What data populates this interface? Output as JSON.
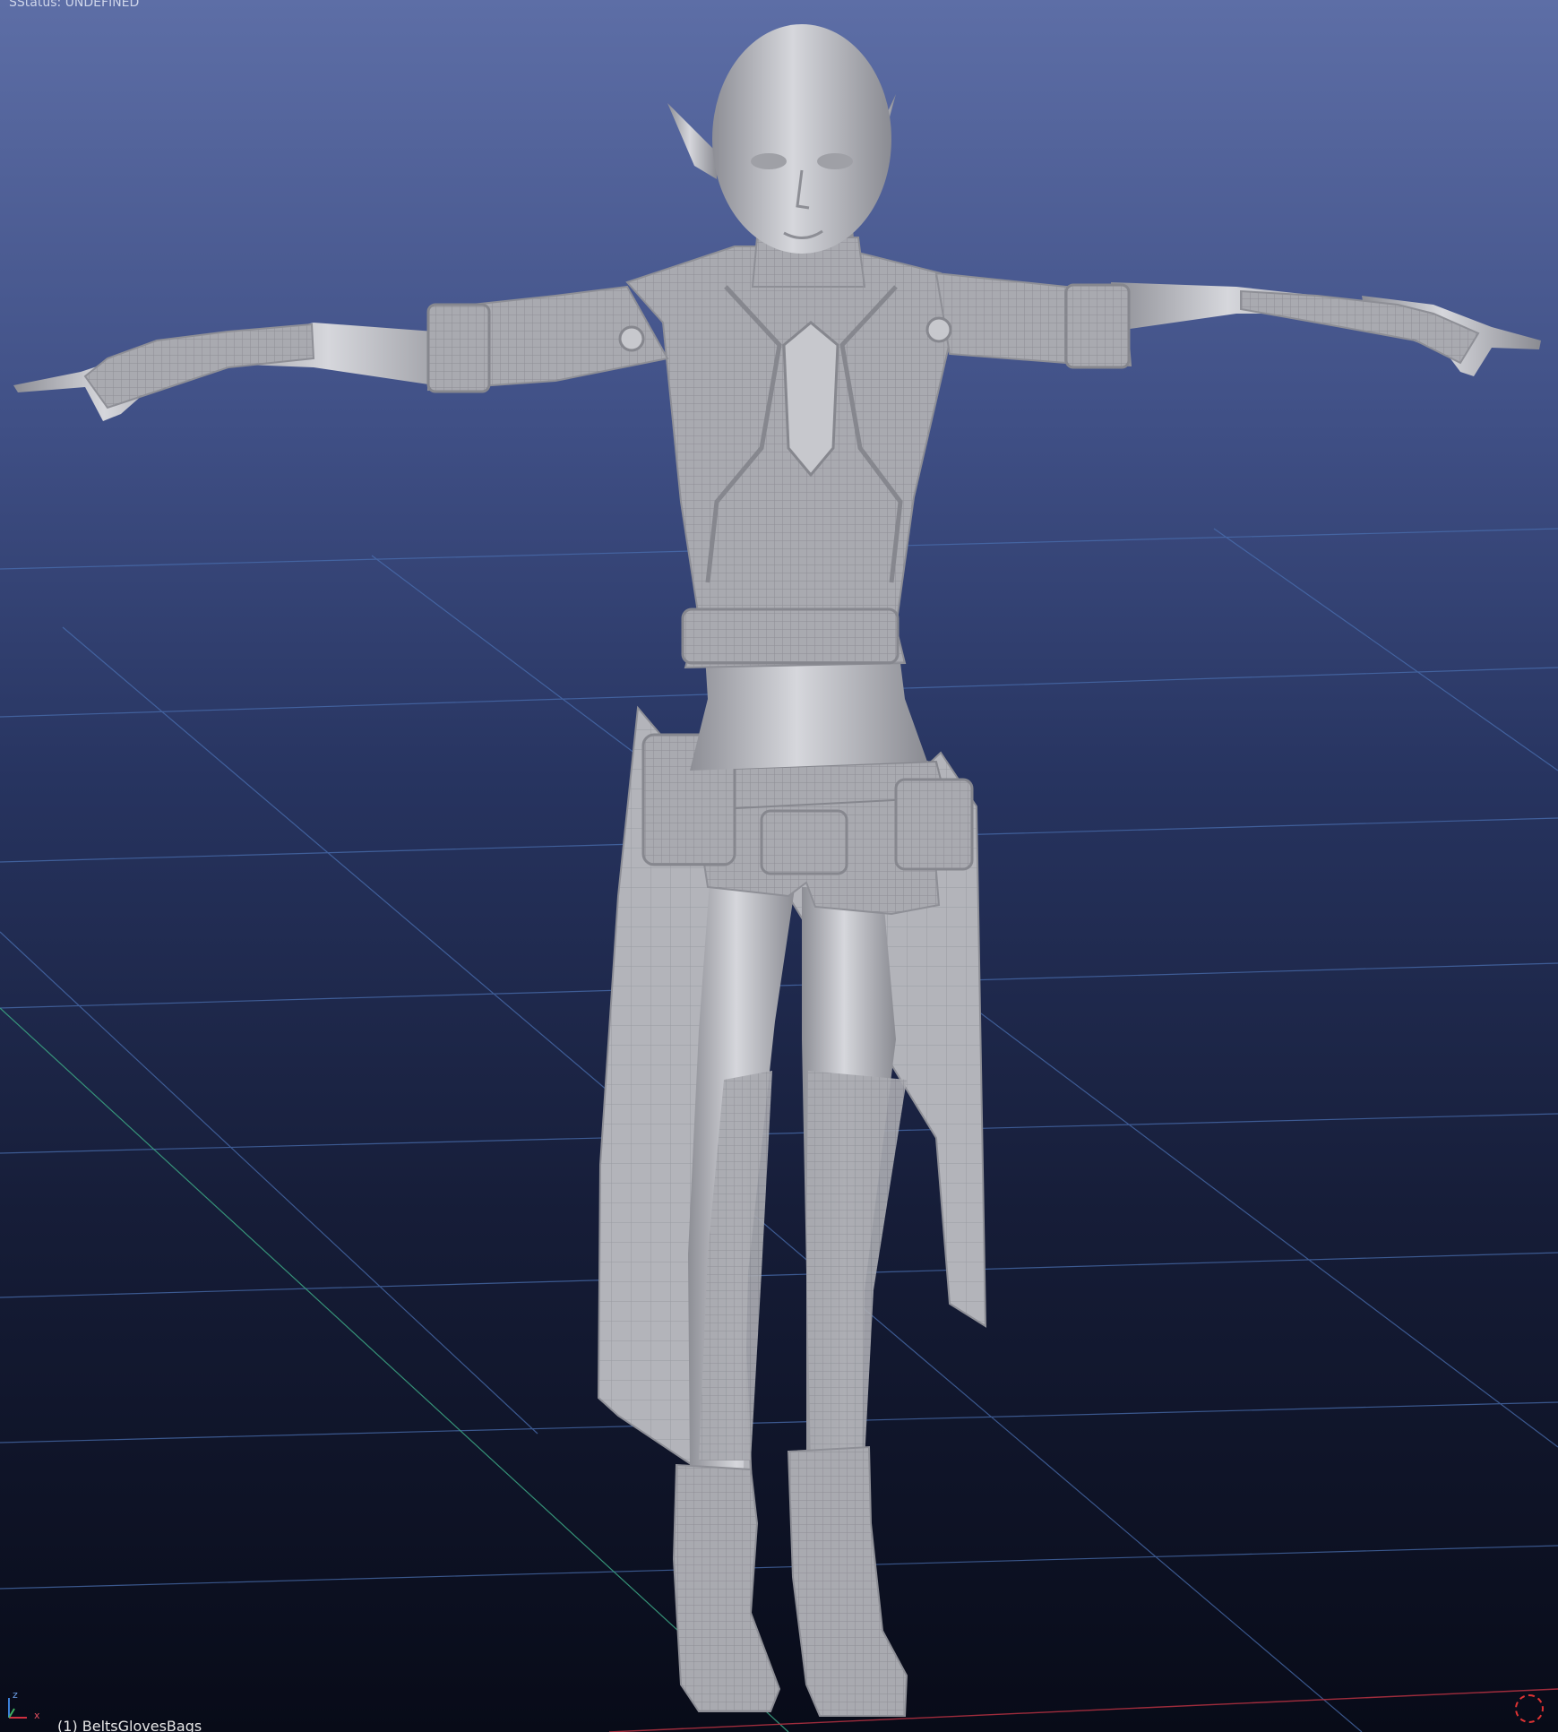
{
  "viewport": {
    "status_text": "SStatus: UNDEFINED",
    "active_object_label": "(1) BeltsGlovesBags",
    "background_top_color": "#5d6ea6",
    "background_bottom_color": "#080b18",
    "grid_line_color": "#4a6fb0",
    "axis_x_color": "#b03040",
    "axis_y_color": "#3aa080",
    "model_color": "#b4b4b6"
  },
  "axis_gizmo": {
    "z_label": "z",
    "x_label": "x"
  }
}
